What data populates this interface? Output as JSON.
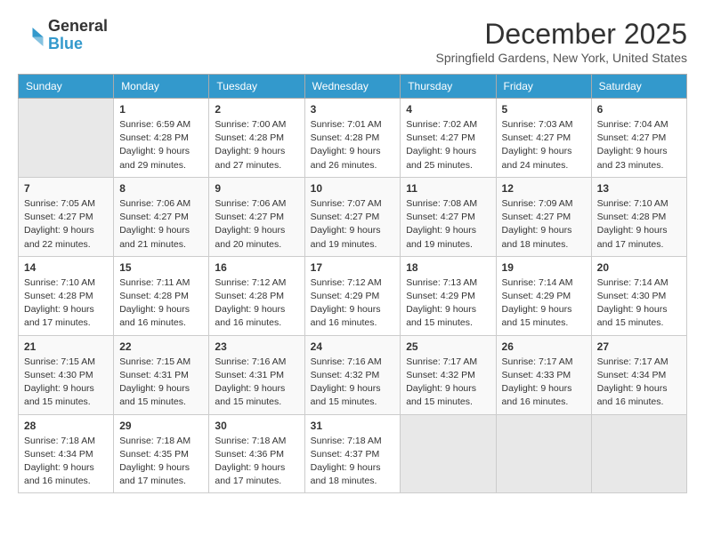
{
  "header": {
    "logo": {
      "line1": "General",
      "line2": "Blue"
    },
    "title": "December 2025",
    "location": "Springfield Gardens, New York, United States"
  },
  "calendar": {
    "days_of_week": [
      "Sunday",
      "Monday",
      "Tuesday",
      "Wednesday",
      "Thursday",
      "Friday",
      "Saturday"
    ],
    "weeks": [
      [
        {
          "day": "",
          "info": ""
        },
        {
          "day": "1",
          "info": "Sunrise: 6:59 AM\nSunset: 4:28 PM\nDaylight: 9 hours\nand 29 minutes."
        },
        {
          "day": "2",
          "info": "Sunrise: 7:00 AM\nSunset: 4:28 PM\nDaylight: 9 hours\nand 27 minutes."
        },
        {
          "day": "3",
          "info": "Sunrise: 7:01 AM\nSunset: 4:28 PM\nDaylight: 9 hours\nand 26 minutes."
        },
        {
          "day": "4",
          "info": "Sunrise: 7:02 AM\nSunset: 4:27 PM\nDaylight: 9 hours\nand 25 minutes."
        },
        {
          "day": "5",
          "info": "Sunrise: 7:03 AM\nSunset: 4:27 PM\nDaylight: 9 hours\nand 24 minutes."
        },
        {
          "day": "6",
          "info": "Sunrise: 7:04 AM\nSunset: 4:27 PM\nDaylight: 9 hours\nand 23 minutes."
        }
      ],
      [
        {
          "day": "7",
          "info": "Sunrise: 7:05 AM\nSunset: 4:27 PM\nDaylight: 9 hours\nand 22 minutes."
        },
        {
          "day": "8",
          "info": "Sunrise: 7:06 AM\nSunset: 4:27 PM\nDaylight: 9 hours\nand 21 minutes."
        },
        {
          "day": "9",
          "info": "Sunrise: 7:06 AM\nSunset: 4:27 PM\nDaylight: 9 hours\nand 20 minutes."
        },
        {
          "day": "10",
          "info": "Sunrise: 7:07 AM\nSunset: 4:27 PM\nDaylight: 9 hours\nand 19 minutes."
        },
        {
          "day": "11",
          "info": "Sunrise: 7:08 AM\nSunset: 4:27 PM\nDaylight: 9 hours\nand 19 minutes."
        },
        {
          "day": "12",
          "info": "Sunrise: 7:09 AM\nSunset: 4:27 PM\nDaylight: 9 hours\nand 18 minutes."
        },
        {
          "day": "13",
          "info": "Sunrise: 7:10 AM\nSunset: 4:28 PM\nDaylight: 9 hours\nand 17 minutes."
        }
      ],
      [
        {
          "day": "14",
          "info": "Sunrise: 7:10 AM\nSunset: 4:28 PM\nDaylight: 9 hours\nand 17 minutes."
        },
        {
          "day": "15",
          "info": "Sunrise: 7:11 AM\nSunset: 4:28 PM\nDaylight: 9 hours\nand 16 minutes."
        },
        {
          "day": "16",
          "info": "Sunrise: 7:12 AM\nSunset: 4:28 PM\nDaylight: 9 hours\nand 16 minutes."
        },
        {
          "day": "17",
          "info": "Sunrise: 7:12 AM\nSunset: 4:29 PM\nDaylight: 9 hours\nand 16 minutes."
        },
        {
          "day": "18",
          "info": "Sunrise: 7:13 AM\nSunset: 4:29 PM\nDaylight: 9 hours\nand 15 minutes."
        },
        {
          "day": "19",
          "info": "Sunrise: 7:14 AM\nSunset: 4:29 PM\nDaylight: 9 hours\nand 15 minutes."
        },
        {
          "day": "20",
          "info": "Sunrise: 7:14 AM\nSunset: 4:30 PM\nDaylight: 9 hours\nand 15 minutes."
        }
      ],
      [
        {
          "day": "21",
          "info": "Sunrise: 7:15 AM\nSunset: 4:30 PM\nDaylight: 9 hours\nand 15 minutes."
        },
        {
          "day": "22",
          "info": "Sunrise: 7:15 AM\nSunset: 4:31 PM\nDaylight: 9 hours\nand 15 minutes."
        },
        {
          "day": "23",
          "info": "Sunrise: 7:16 AM\nSunset: 4:31 PM\nDaylight: 9 hours\nand 15 minutes."
        },
        {
          "day": "24",
          "info": "Sunrise: 7:16 AM\nSunset: 4:32 PM\nDaylight: 9 hours\nand 15 minutes."
        },
        {
          "day": "25",
          "info": "Sunrise: 7:17 AM\nSunset: 4:32 PM\nDaylight: 9 hours\nand 15 minutes."
        },
        {
          "day": "26",
          "info": "Sunrise: 7:17 AM\nSunset: 4:33 PM\nDaylight: 9 hours\nand 16 minutes."
        },
        {
          "day": "27",
          "info": "Sunrise: 7:17 AM\nSunset: 4:34 PM\nDaylight: 9 hours\nand 16 minutes."
        }
      ],
      [
        {
          "day": "28",
          "info": "Sunrise: 7:18 AM\nSunset: 4:34 PM\nDaylight: 9 hours\nand 16 minutes."
        },
        {
          "day": "29",
          "info": "Sunrise: 7:18 AM\nSunset: 4:35 PM\nDaylight: 9 hours\nand 17 minutes."
        },
        {
          "day": "30",
          "info": "Sunrise: 7:18 AM\nSunset: 4:36 PM\nDaylight: 9 hours\nand 17 minutes."
        },
        {
          "day": "31",
          "info": "Sunrise: 7:18 AM\nSunset: 4:37 PM\nDaylight: 9 hours\nand 18 minutes."
        },
        {
          "day": "",
          "info": ""
        },
        {
          "day": "",
          "info": ""
        },
        {
          "day": "",
          "info": ""
        }
      ]
    ]
  }
}
